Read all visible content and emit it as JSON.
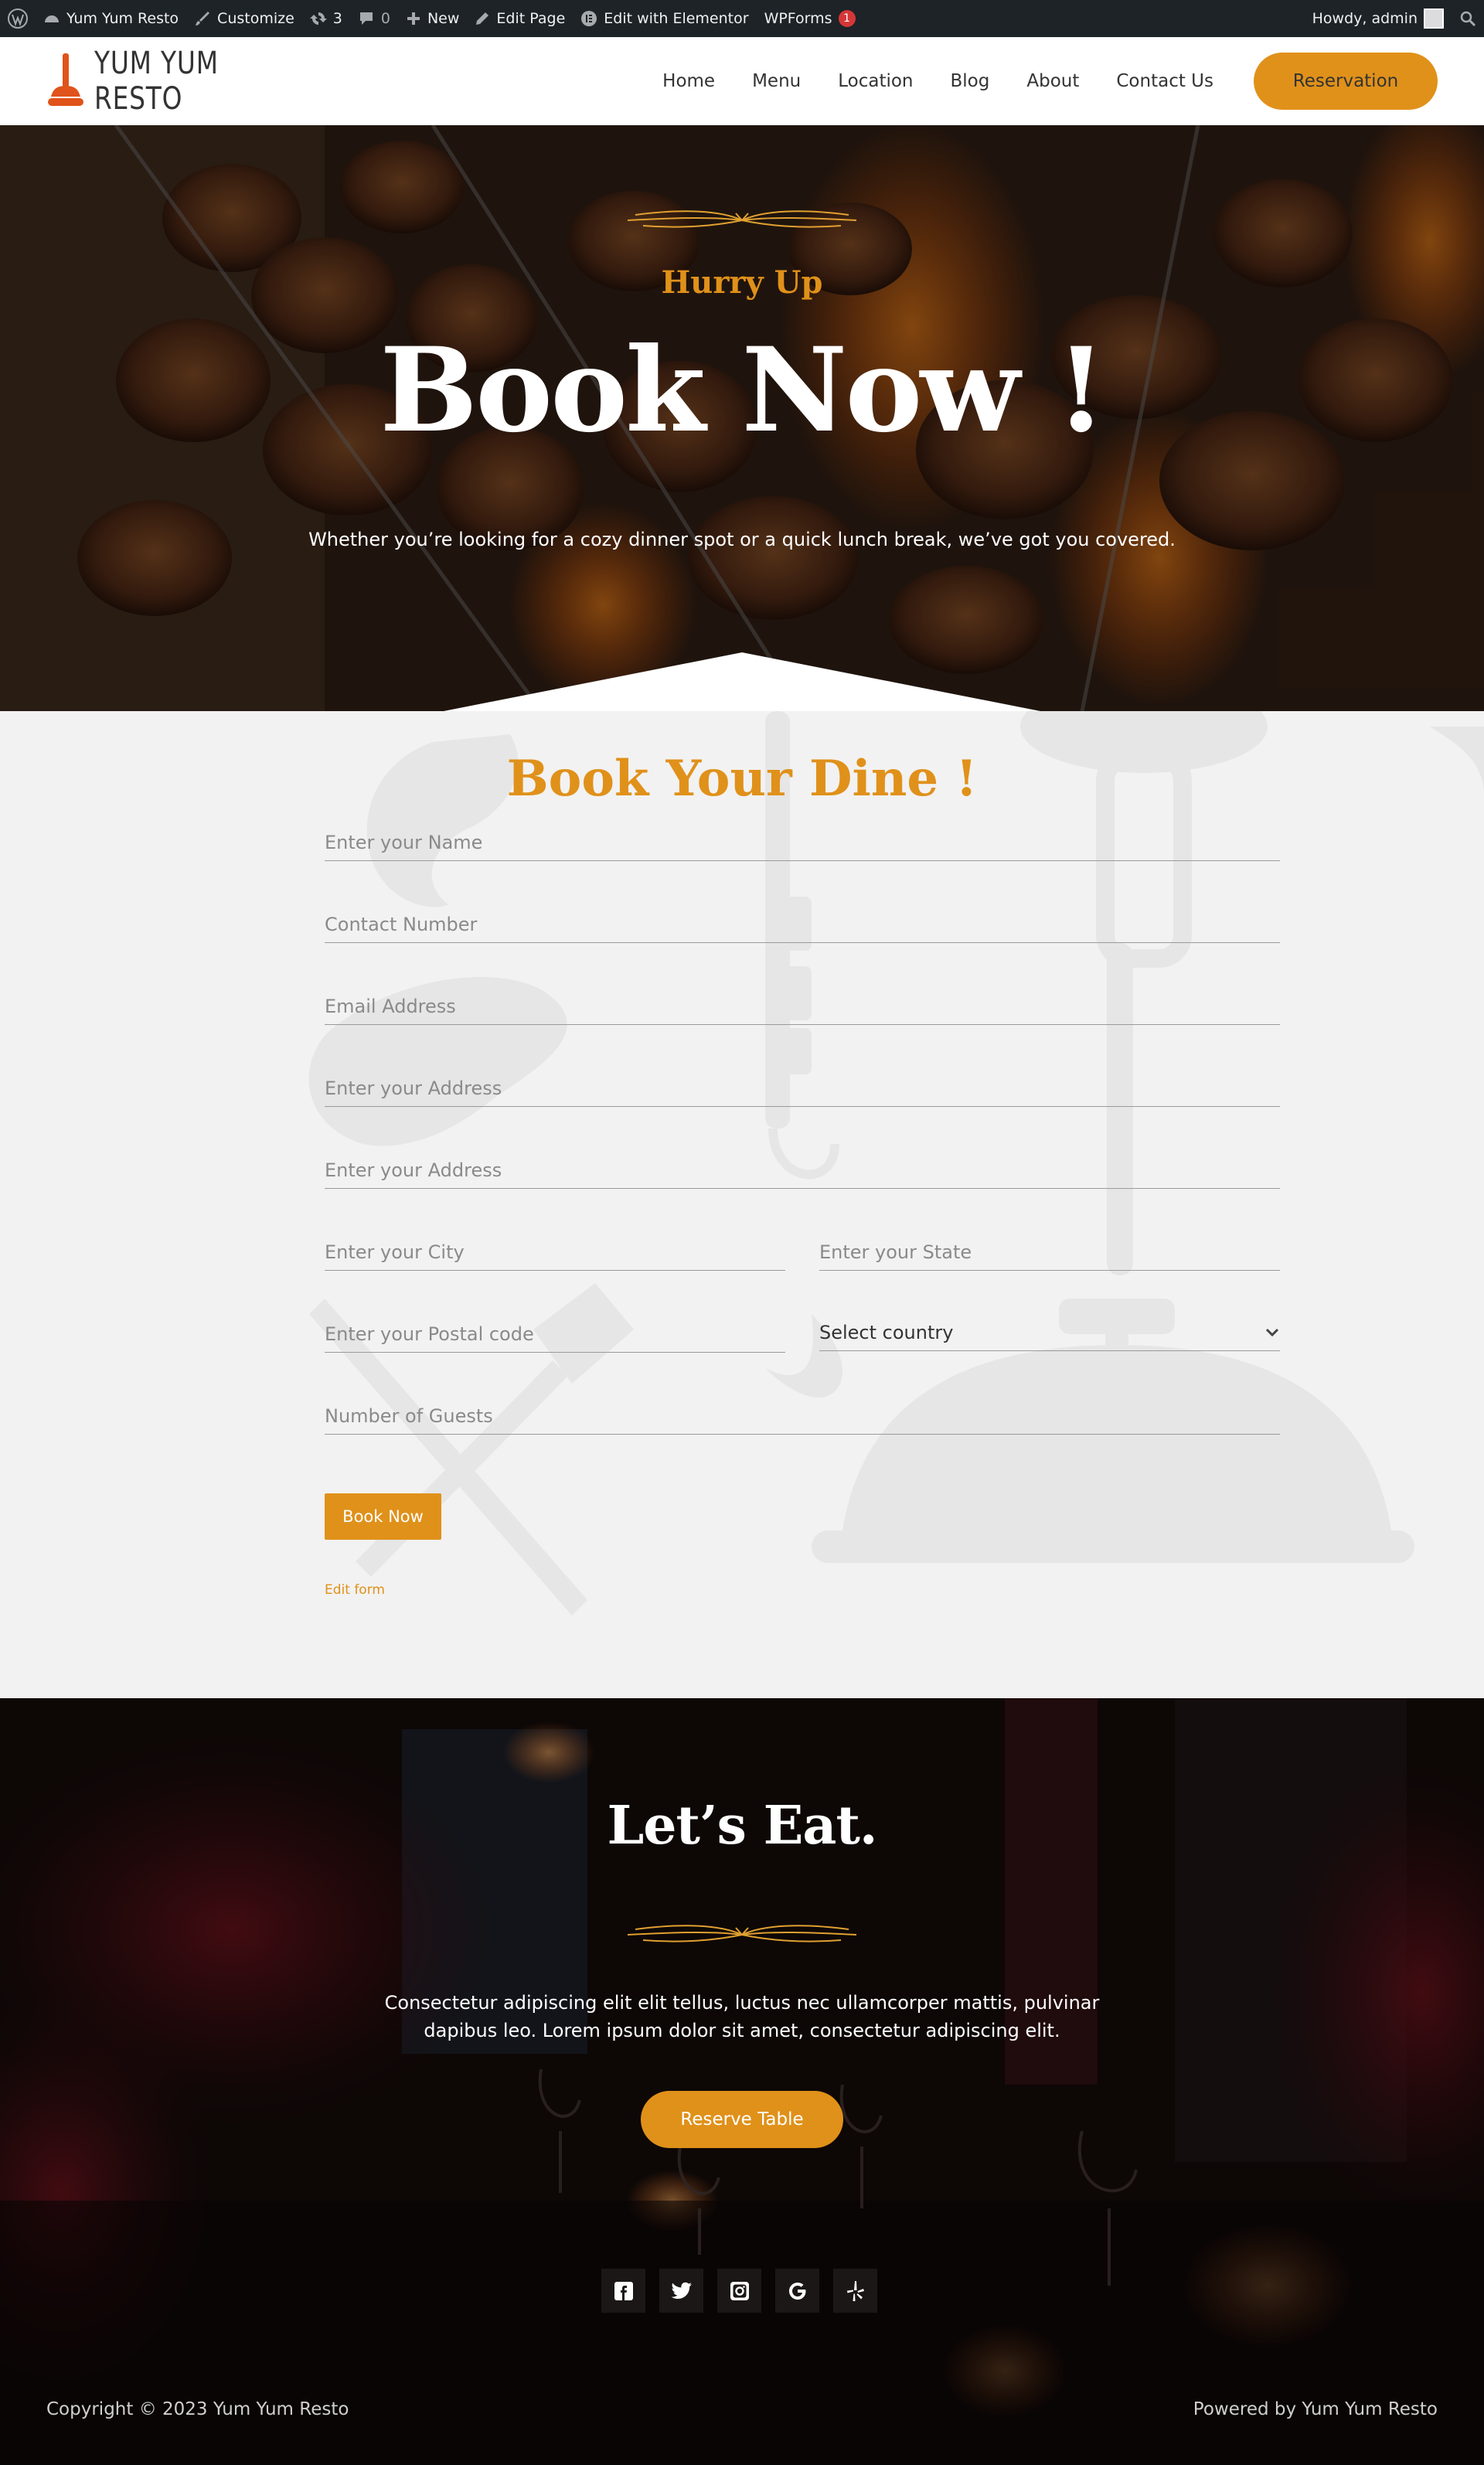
{
  "admin_bar": {
    "site_name": "Yum Yum Resto",
    "customize": "Customize",
    "updates_count": "3",
    "comments_count": "0",
    "new_label": "New",
    "edit_page": "Edit Page",
    "edit_elementor": "Edit with Elementor",
    "wpforms": "WPForms",
    "wpforms_badge": "1",
    "howdy": "Howdy, admin"
  },
  "header": {
    "logo_text": "YUM YUM RESTO",
    "nav": [
      "Home",
      "Menu",
      "Location",
      "Blog",
      "About",
      "Contact Us"
    ],
    "reservation_button": "Reservation"
  },
  "hero": {
    "eyebrow": "Hurry Up",
    "title": "Book Now !",
    "subtitle": "Whether you’re looking for a cozy dinner spot or a quick lunch break, we’ve got you covered."
  },
  "booking": {
    "title": "Book Your Dine !",
    "fields": {
      "name": "Enter your Name",
      "phone": "Contact Number",
      "email": "Email Address",
      "address1": "Enter your Address",
      "address2": "Enter your Address",
      "city": "Enter your City",
      "state": "Enter your State",
      "postal": "Enter your Postal code",
      "country": "Select country",
      "guests": "Number of Guests"
    },
    "submit": "Book Now",
    "edit_form": "Edit form"
  },
  "cta": {
    "title": "Let’s Eat.",
    "text": "Consectetur adipiscing elit elit tellus, luctus nec ullamcorper mattis, pulvinar dapibus leo. Lorem ipsum dolor sit amet, consectetur adipiscing elit.",
    "button": "Reserve Table",
    "socials": [
      "facebook-icon",
      "twitter-icon",
      "instagram-icon",
      "google-icon",
      "yelp-icon"
    ]
  },
  "footer": {
    "copyright": "Copyright © 2023 Yum Yum Resto",
    "powered": "Powered by Yum Yum Resto"
  },
  "colors": {
    "accent": "#e0911a",
    "admin_bar": "#1d2327",
    "section_bg": "#f2f2f2",
    "badge": "#d63638"
  }
}
